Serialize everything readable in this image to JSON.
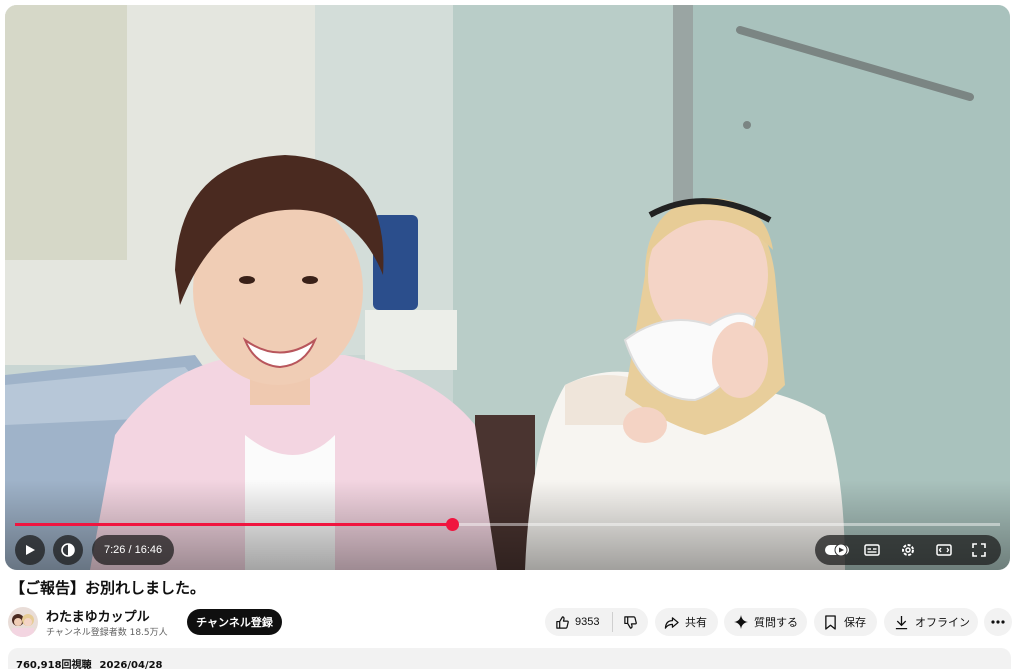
{
  "player": {
    "time_display": "7:26 / 16:46",
    "progress_fraction": 0.4433
  },
  "video": {
    "title": "【ご報告】お別れしました。",
    "views": "760,918回視聴",
    "date": "2026/04/28"
  },
  "channel": {
    "name": "わたまゆカップル",
    "subscribers": "チャンネル登録者数 18.5万人",
    "subscribe_label": "チャンネル登録"
  },
  "actions": {
    "like_count": "9353",
    "share_label": "共有",
    "ask_label": "質問する",
    "save_label": "保存",
    "offline_label": "オフライン"
  },
  "colors": {
    "progress": "#f0153f",
    "subscribe_bg": "#0f0f0f",
    "pill_bg": "#f2f2f2"
  },
  "icons": [
    "play-icon",
    "volume-icon",
    "autoplay-toggle-icon",
    "subtitles-icon",
    "settings-icon",
    "theater-icon",
    "fullscreen-icon",
    "like-icon",
    "dislike-icon",
    "share-icon",
    "sparkle-icon",
    "save-icon",
    "download-icon",
    "more-icon"
  ]
}
